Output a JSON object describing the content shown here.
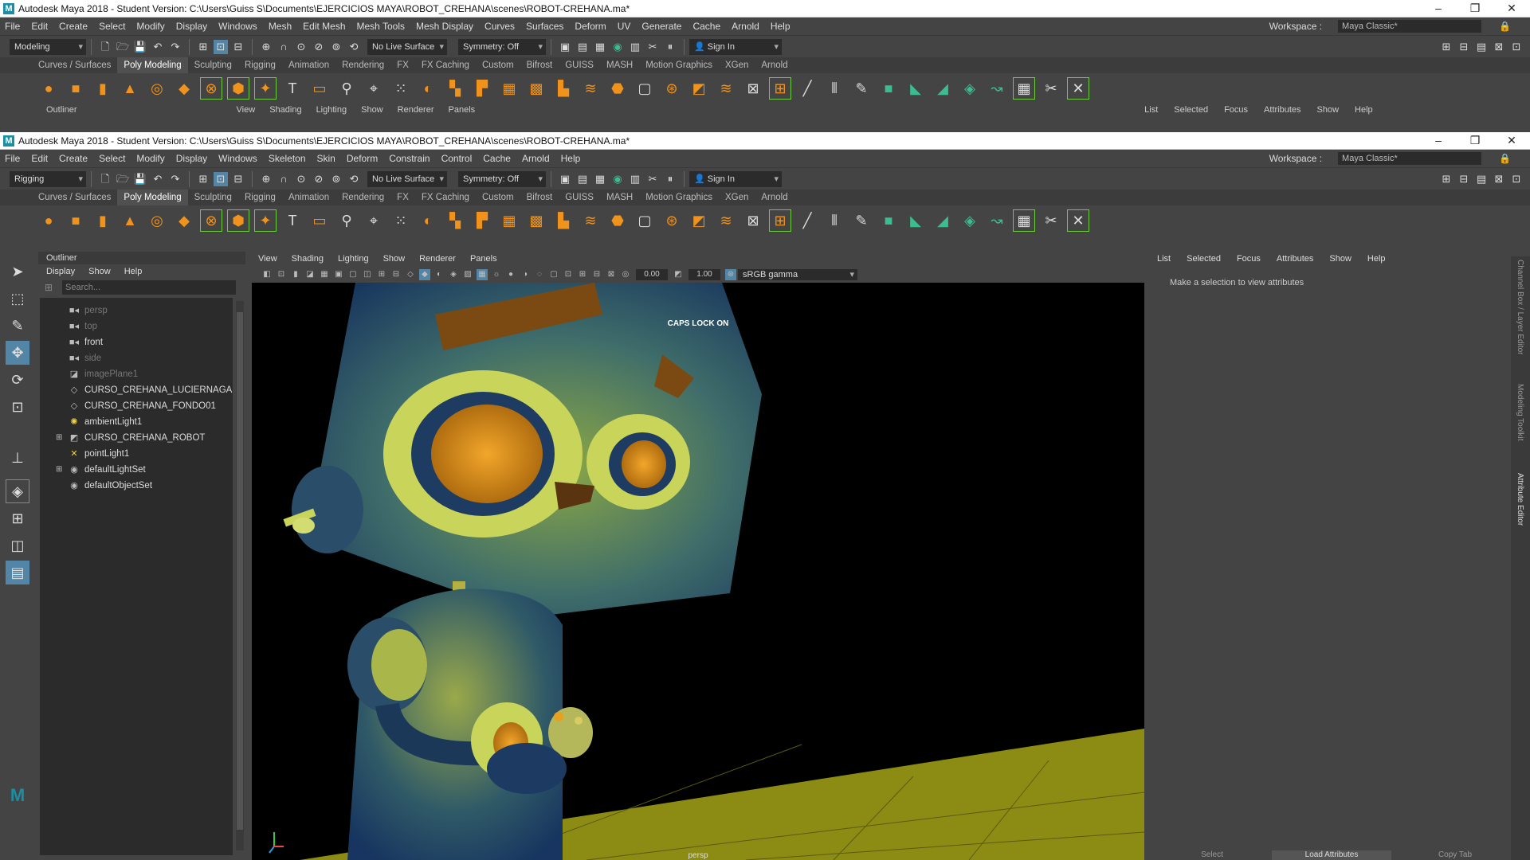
{
  "window_back": {
    "title": "Autodesk Maya 2018 - Student Version: C:\\Users\\Guiss S\\Documents\\EJERCICIOS MAYA\\ROBOT_CREHANA\\scenes\\ROBOT-CREHANA.ma*",
    "menu": [
      "File",
      "Edit",
      "Create",
      "Select",
      "Modify",
      "Display",
      "Windows",
      "Mesh",
      "Edit Mesh",
      "Mesh Tools",
      "Mesh Display",
      "Curves",
      "Surfaces",
      "Deform",
      "UV",
      "Generate",
      "Cache",
      "Arnold",
      "Help"
    ],
    "mode": "Modeling",
    "outliner_tab": "Outliner",
    "vp_menu": [
      "View",
      "Shading",
      "Lighting",
      "Show",
      "Renderer",
      "Panels"
    ],
    "attr_menu": [
      "List",
      "Selected",
      "Focus",
      "Attributes",
      "Show",
      "Help"
    ]
  },
  "window_front": {
    "title": "Autodesk Maya 2018 - Student Version: C:\\Users\\Guiss S\\Documents\\EJERCICIOS MAYA\\ROBOT_CREHANA\\scenes\\ROBOT-CREHANA.ma*",
    "menu": [
      "File",
      "Edit",
      "Create",
      "Select",
      "Modify",
      "Display",
      "Windows",
      "Skeleton",
      "Skin",
      "Deform",
      "Constrain",
      "Control",
      "Cache",
      "Arnold",
      "Help"
    ],
    "mode": "Rigging"
  },
  "workspace": {
    "label": "Workspace :",
    "value": "Maya Classic*"
  },
  "status": {
    "live_surface": "No Live Surface",
    "symmetry": "Symmetry: Off",
    "sign_in": "Sign In"
  },
  "shelf_tabs": [
    "Curves / Surfaces",
    "Poly Modeling",
    "Sculpting",
    "Rigging",
    "Animation",
    "Rendering",
    "FX",
    "FX Caching",
    "Custom",
    "Bifrost",
    "GUISS",
    "MASH",
    "Motion Graphics",
    "XGen",
    "Arnold"
  ],
  "shelf_active": "Poly Modeling",
  "outliner": {
    "tab": "Outliner",
    "menu": [
      "Display",
      "Show",
      "Help"
    ],
    "search_placeholder": "Search...",
    "items": [
      {
        "label": "persp",
        "icon": "camera-icon",
        "dim": true
      },
      {
        "label": "top",
        "icon": "camera-icon",
        "dim": true
      },
      {
        "label": "front",
        "icon": "camera-icon",
        "dim": false
      },
      {
        "label": "side",
        "icon": "camera-icon",
        "dim": true
      },
      {
        "label": "imagePlane1",
        "icon": "image-plane-icon",
        "dim": true
      },
      {
        "label": "CURSO_CREHANA_LUCIERNAGA",
        "icon": "group-icon",
        "dim": false
      },
      {
        "label": "CURSO_CREHANA_FONDO01",
        "icon": "group-icon",
        "dim": false
      },
      {
        "label": "ambientLight1",
        "icon": "ambient-light-icon",
        "dim": false
      },
      {
        "label": "CURSO_CREHANA_ROBOT",
        "icon": "mesh-icon",
        "dim": false,
        "expandable": true
      },
      {
        "label": "pointLight1",
        "icon": "point-light-icon",
        "dim": false
      },
      {
        "label": "defaultLightSet",
        "icon": "set-icon",
        "dim": false,
        "expandable": true
      },
      {
        "label": "defaultObjectSet",
        "icon": "set-icon",
        "dim": false
      }
    ]
  },
  "viewport": {
    "menu": [
      "View",
      "Shading",
      "Lighting",
      "Show",
      "Renderer",
      "Panels"
    ],
    "exposure": "0.00",
    "gamma": "1.00",
    "color_space": "sRGB gamma",
    "hud_message": "CAPS LOCK ON",
    "camera_label": "persp"
  },
  "attribute_editor": {
    "menu": [
      "List",
      "Selected",
      "Focus",
      "Attributes",
      "Show",
      "Help"
    ],
    "message": "Make a selection to view attributes",
    "buttons": [
      "Select",
      "Load Attributes",
      "Copy Tab"
    ]
  },
  "side_tabs": [
    "Channel Box / Layer Editor",
    "Modeling Toolkit",
    "Attribute Editor"
  ],
  "colors": {
    "accent": "#5285a6",
    "shelf_orange": "#f0931d",
    "shelf_green": "#3dbd8f",
    "floor": "#8c8c15"
  }
}
